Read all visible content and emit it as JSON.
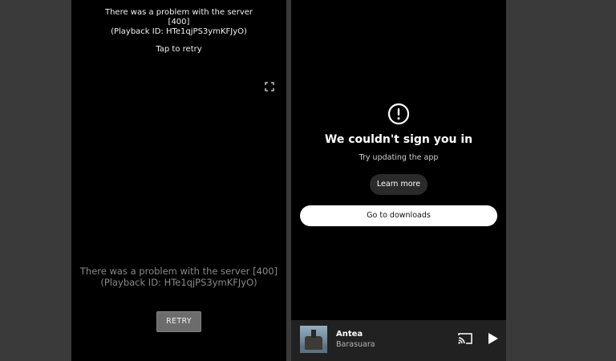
{
  "left_phone": {
    "error_top_line1": "There was a problem with the server",
    "error_top_line2": "[400]",
    "error_top_line3": "(Playback ID: HTe1qjPS3ymKFJyO)",
    "tap_to_retry": "Tap to retry",
    "error_mid_line1": "There was a problem with the server [400]",
    "error_mid_line2": "(Playback ID: HTe1qjPS3ymKFJyO)",
    "retry_label": "RETRY",
    "icons": {
      "fullscreen": "fullscreen-icon"
    }
  },
  "right_phone": {
    "title": "We couldn't sign you in",
    "subtitle": "Try updating the app",
    "learn_more": "Learn more",
    "go_to_downloads": "Go to downloads",
    "mini_player": {
      "track_title": "Antea",
      "artist": "Barasuara"
    },
    "icons": {
      "alert": "alert-circle-icon",
      "cast": "cast-icon",
      "play": "play-icon"
    }
  },
  "colors": {
    "background": "#3a3a3a",
    "screen": "#000000",
    "retry_button": "#6c6c6c",
    "pill_dark": "#2a2a2a",
    "pill_light": "#ffffff",
    "mini_player": "#212121"
  }
}
